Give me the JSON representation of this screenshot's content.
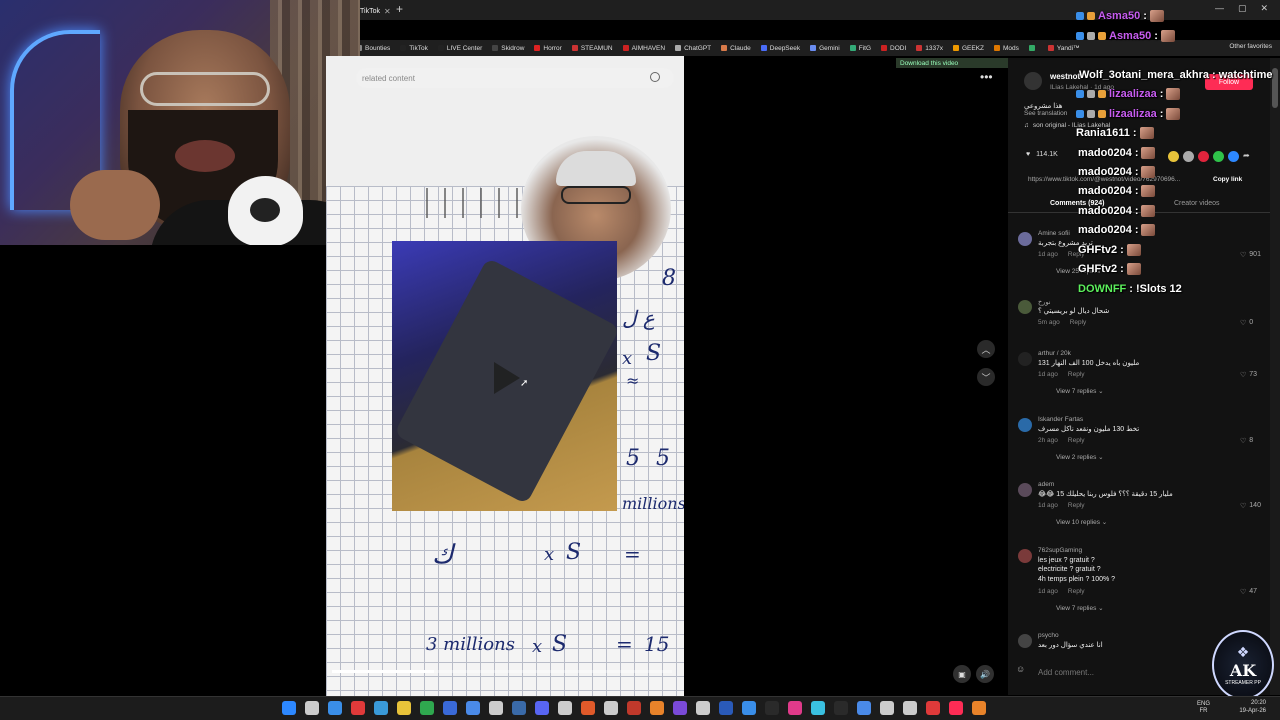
{
  "browser": {
    "tab_title": "TikTok",
    "tab_close": "✕",
    "new_tab": "+",
    "window_controls": [
      "—",
      "▢",
      "✕"
    ],
    "bookmarks": [
      {
        "label": "Bounties",
        "color": "#888"
      },
      {
        "label": "TikTok",
        "color": "#222"
      },
      {
        "label": "LIVE Center",
        "color": "#222"
      },
      {
        "label": "Skidrow",
        "color": "#444"
      },
      {
        "label": "Horror",
        "color": "#d22"
      },
      {
        "label": "STEAMUN",
        "color": "#c33"
      },
      {
        "label": "AIMHAVEN",
        "color": "#c22"
      },
      {
        "label": "ChatGPT",
        "color": "#aaa"
      },
      {
        "label": "Claude",
        "color": "#d87a4a"
      },
      {
        "label": "DeepSeek",
        "color": "#4a6cf7"
      },
      {
        "label": "Gemini",
        "color": "#6a8cf0"
      },
      {
        "label": "FitG",
        "color": "#3a7"
      },
      {
        "label": "DODI",
        "color": "#c22"
      },
      {
        "label": "1337x",
        "color": "#c33"
      },
      {
        "label": "GEEKZ",
        "color": "#e90"
      },
      {
        "label": "Mods",
        "color": "#d70"
      },
      {
        "label": "",
        "color": "#3a6"
      },
      {
        "label": "Yandi™",
        "color": "#c33"
      }
    ],
    "other_favorites": "Other favorites"
  },
  "video": {
    "search_placeholder": "related content",
    "download_label": "Download this video",
    "more_label": "•••",
    "nav_up": "︿",
    "nav_down": "﹀",
    "play_hint": "▶",
    "handwriting": [
      "8",
      "ع ل",
      "x",
      "S",
      "≈",
      "5",
      "5",
      "millions",
      "ك",
      "x",
      "S",
      "=",
      "3 millions",
      "x",
      "S",
      "=",
      "15"
    ]
  },
  "post": {
    "author": "westnot",
    "author_sub": "ILias Lakehal · 1d ago",
    "follow": "Follow",
    "caption": "هذا مشروعي",
    "see_translation": "See translation",
    "sound": "son original - ILias Lakehal",
    "likes": "114.1K",
    "url": "https://www.tiktok.com/@westnot/video/762970696...",
    "copy_link": "Copy link",
    "tab_comments": "Comments (924)",
    "tab_creator": "Creator videos",
    "add_comment_placeholder": "Add comment..."
  },
  "comments": [
    {
      "name": "Amine sofii",
      "text": "تريد مشروع بتجربة",
      "meta_time": "1d ago",
      "reply": "Reply",
      "likes": "901",
      "view_replies": "View 25 replies",
      "avatar_color": "#6b6b9b"
    },
    {
      "name": "نورخ",
      "text": "شحال ديال لو بريسيتي ؟",
      "meta_time": "5m ago",
      "reply": "Reply",
      "likes": "0",
      "view_replies": "",
      "avatar_color": "#4a5a3a"
    },
    {
      "name": "arthur / 20k",
      "text": "131 مليون باه يدخل 100 الف النهار",
      "meta_time": "1d ago",
      "reply": "Reply",
      "likes": "73",
      "view_replies": "View 7 replies",
      "avatar_color": "#222"
    },
    {
      "name": "Iskander Fartas",
      "text": "تخط 130 مليون ونقعد ناكل مسرف",
      "meta_time": "2h ago",
      "reply": "Reply",
      "likes": "8",
      "view_replies": "View 2 replies",
      "avatar_color": "#2a6aa8"
    },
    {
      "name": "adem",
      "text": "😂😂 15 مليار 15 دقيقة ؟؟؟ فلوس ربنا يحليلك",
      "meta_time": "1d ago",
      "reply": "Reply",
      "likes": "140",
      "view_replies": "View 10 replies",
      "avatar_color": "#5a4a5a"
    },
    {
      "name": "762supGaming",
      "text": "les jeux ? gratuit ?\nelectricite ? gratuit ?\n4h temps plein ? 100% ?",
      "meta_time": "1d ago",
      "reply": "Reply",
      "likes": "47",
      "view_replies": "View 7 replies",
      "avatar_color": "#7a3a3a"
    },
    {
      "name": "psycho",
      "text": "انا عندي سؤال دور بعد",
      "meta_time": "",
      "reply": "",
      "likes": "",
      "view_replies": "",
      "avatar_color": "#444"
    }
  ],
  "chat": [
    {
      "user": "Asma50",
      "sep": ":",
      "msg": "",
      "color": "#c75cf0"
    },
    {
      "user": "Wolf_3otani_mera_akhra",
      "sep": ":",
      "msg": "watchtime",
      "color": "#ffffff"
    },
    {
      "user": "lizaalizaa",
      "sep": ":",
      "msg": "",
      "color": "#c75cf0"
    },
    {
      "user": "lizaalizaa",
      "sep": ":",
      "msg": "",
      "color": "#c75cf0"
    },
    {
      "user": "Rania1611",
      "sep": ":",
      "msg": "",
      "color": "#ffffff"
    },
    {
      "user": "mado0204",
      "sep": ":",
      "msg": "",
      "color": "#ffffff"
    },
    {
      "user": "mado0204",
      "sep": ":",
      "msg": "",
      "color": "#ffffff"
    },
    {
      "user": "mado0204",
      "sep": ":",
      "msg": "",
      "color": "#ffffff"
    },
    {
      "user": "mado0204",
      "sep": ":",
      "msg": "",
      "color": "#ffffff"
    },
    {
      "user": "mado0204",
      "sep": ":",
      "msg": "",
      "color": "#ffffff"
    },
    {
      "user": "GHFtv2",
      "sep": ":",
      "msg": "",
      "color": "#ffffff"
    },
    {
      "user": "GHFtv2",
      "sep": ":",
      "msg": "",
      "color": "#ffffff"
    },
    {
      "user": "DOWNFF",
      "sep": ":",
      "msg": "!Slots 12",
      "color": "#5cf05c"
    }
  ],
  "chat_top": {
    "user": "Asma50",
    "sep": ":"
  },
  "logo": {
    "line1": "AK",
    "line2": "STREAMER PP"
  },
  "taskbar": {
    "lang": "ENG\nFR",
    "time": "20:20",
    "date": "19-Apr-26"
  },
  "colors": {
    "accent": "#fe2c55",
    "panel_bg": "#121212",
    "chat_purple": "#c75cf0",
    "chat_green": "#5cf05c"
  }
}
